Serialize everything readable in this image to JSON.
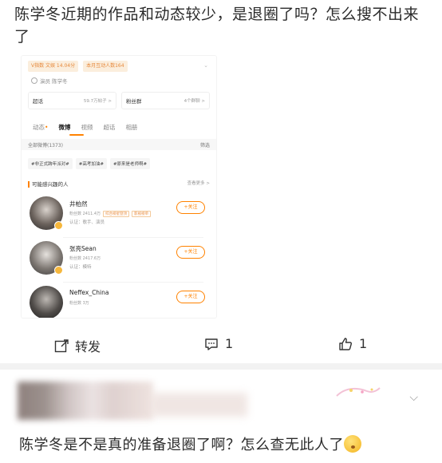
{
  "post": {
    "text": "陈学冬近期的作品和动态较少，是退圈了吗？怎么搜不出来了"
  },
  "screenshot": {
    "tags": [
      "V指数 文娱 14.04分",
      "本月互动人数164"
    ],
    "identity": "演员 陈学冬",
    "boxes": [
      {
        "label": "超话",
        "meta": "59.7万帖子 >"
      },
      {
        "label": "粉丝群",
        "meta": "4个群聊 >"
      }
    ],
    "tabs": [
      "动态",
      "微博",
      "视频",
      "超话",
      "相册"
    ],
    "active_tab": "微博",
    "all_weibo": "全部微博(1373)",
    "filter": "筛选",
    "chips": [
      "#非正式跨年派对#",
      "#高考加油#",
      "#原来是老师啊#"
    ],
    "suggest_title": "可能感兴趣的人",
    "suggest_more": "查看更多 >",
    "people": [
      {
        "name": "井柏然",
        "fans": "粉丝数 2411.4万",
        "tag1": "综合榜星登顶",
        "tag2": "影视榜单",
        "cert": "认证：歌手、演员",
        "follow": "+关注"
      },
      {
        "name": "张亮Sean",
        "fans": "粉丝数 2417.6万",
        "tag1": "",
        "tag2": "",
        "cert": "认证：模特",
        "follow": "+关注"
      },
      {
        "name": "Neffex_China",
        "fans": "粉丝数 3万",
        "tag1": "",
        "tag2": "",
        "cert": "",
        "follow": "+关注"
      }
    ]
  },
  "actions": {
    "repost": "转发",
    "comment_count": "1",
    "like_count": "1"
  },
  "comment": {
    "text": "陈学冬是不是真的准备退圈了啊？怎么查无此人了"
  },
  "colors": {
    "accent": "#ff8200",
    "tag_bg": "#fbeedd",
    "divider": "#f2f2f2"
  }
}
